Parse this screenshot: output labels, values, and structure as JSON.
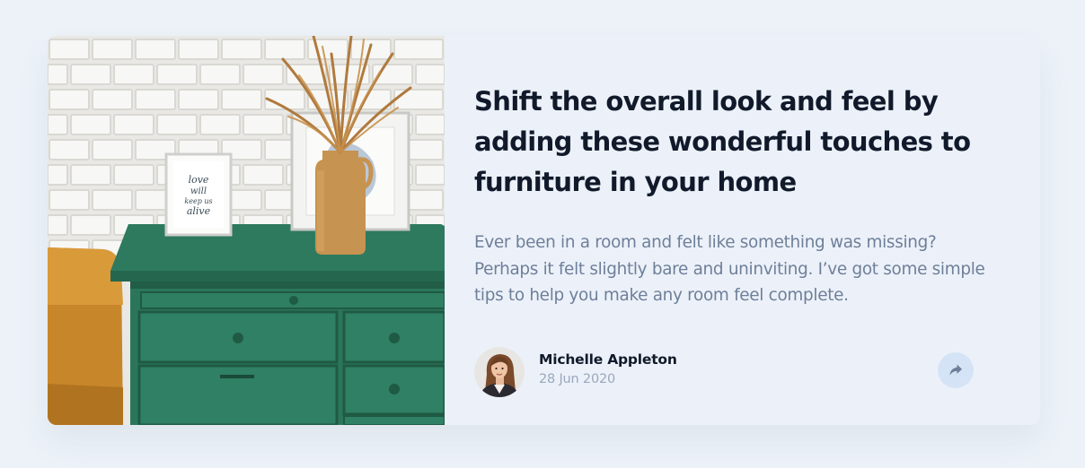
{
  "card": {
    "image_alt": "Green dresser with a framed print reading love will keep us alive and a vase of dried grass",
    "title": "Shift the overall look and feel by adding these wonderful touches to furniture in your home",
    "description": "Ever been in a room and felt like something was missing? Perhaps it felt slightly bare and uninviting. I’ve got some simple tips to help you make any room feel complete.",
    "author": {
      "name": "Michelle Appleton",
      "date": "28 Jun 2020"
    },
    "share_label": "Share"
  },
  "colors": {
    "page_background": "#ecf2f8",
    "card_background": "#ecf1f9",
    "title": "#111a2b",
    "body_text": "#6e7f99",
    "date_text": "#9aa8bd",
    "share_button_bg": "#d5e3f7",
    "share_icon": "#6e7f99"
  },
  "icons": {
    "share": "share-arrow-icon"
  }
}
